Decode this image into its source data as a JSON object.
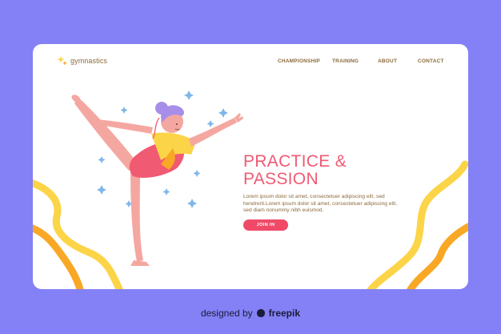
{
  "logo": {
    "text": "gymnastics",
    "icon": "sparkle-icon"
  },
  "nav": {
    "items": [
      {
        "label": "CHAMPIONSHIP"
      },
      {
        "label": "TRAINING"
      },
      {
        "label": "ABOUT"
      },
      {
        "label": "CONTACT"
      }
    ]
  },
  "hero": {
    "headline_line1": "PRACTICE &",
    "headline_line2": "PASSION",
    "body": "Lorem ipsum dolor sit amet, consectetuer adipiscing elit, sed hendrerit.Lorem ipsum dolor sit amet, consectetuer adipiscing elit, sed diam nonummy nibh euismod.",
    "button_label": "JOIN IN"
  },
  "footer": {
    "prefix": "designed by",
    "brand": "freepik",
    "icon": "freepik-logo-icon"
  },
  "colors": {
    "background": "#8381f5",
    "card": "#ffffff",
    "accent": "#f05a73",
    "text": "#8b6a3a",
    "wave_yellow": "#fcd448",
    "wave_orange": "#f9a825"
  }
}
